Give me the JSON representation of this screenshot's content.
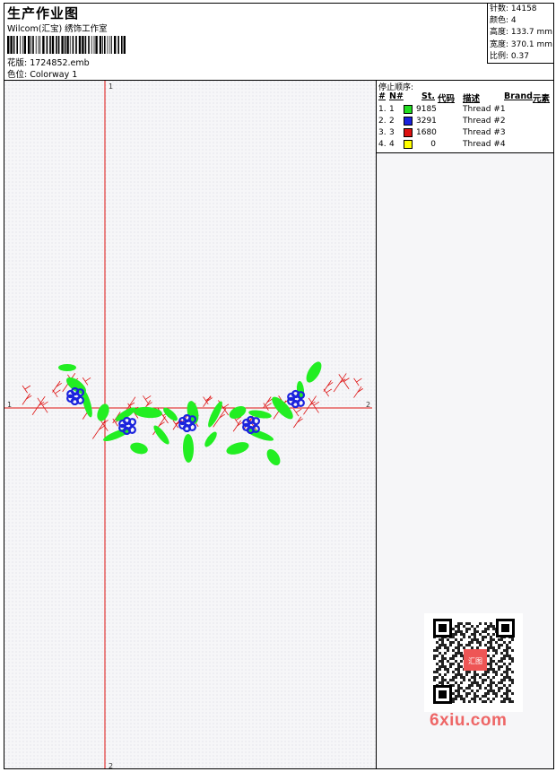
{
  "header": {
    "title": "生产作业图",
    "company": "Wilcom(汇宝) 绣饰工作室",
    "design_label": "花版: 1724852.emb",
    "colorway_label": "色位: Colorway 1"
  },
  "info": {
    "stitches": "针数: 14158",
    "colors": "颜色: 4",
    "height": "高度: 133.7 mm",
    "width": "宽度: 370.1 mm",
    "scale": "比例: 0.37"
  },
  "stop_sequence": {
    "title": "停止顺序:",
    "headers": {
      "hash": "#",
      "num": "N#",
      "st": "St.",
      "code": "代码",
      "desc": "描述",
      "brand": "Brand",
      "element": "元素"
    },
    "rows": [
      {
        "idx": "1.",
        "n": "1",
        "color": "#22dd22",
        "st": "9185",
        "desc": "Thread #1"
      },
      {
        "idx": "2.",
        "n": "2",
        "color": "#1a22dd",
        "st": "3291",
        "desc": "Thread #2"
      },
      {
        "idx": "3.",
        "n": "3",
        "color": "#dd1111",
        "st": "1680",
        "desc": "Thread #3"
      },
      {
        "idx": "4.",
        "n": "4",
        "color": "#ffff00",
        "st": "0",
        "desc": "Thread #4"
      }
    ]
  },
  "axes": {
    "top_marker": "1",
    "bottom_marker": "2",
    "left_marker": "1",
    "right_marker": "2"
  },
  "colors": {
    "leaf": "#22ee22",
    "flower": "#1a22dd",
    "branch": "#dd1111",
    "axis": "#dd1111"
  },
  "watermark": "6xiu.com",
  "seal_text": "汇图"
}
